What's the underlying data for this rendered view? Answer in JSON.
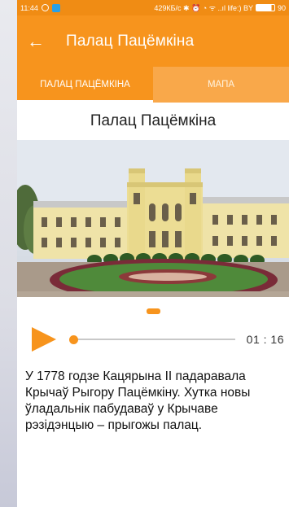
{
  "status_bar": {
    "time": "11:44",
    "network_info": "429КБ/с ✱ ⏰ ◔ ᯤ ..ıl life:) BY",
    "battery": "90"
  },
  "app_bar": {
    "back_icon": "arrow-left-icon",
    "title": "Палац Пацёмкіна"
  },
  "tabs": [
    {
      "label": "ПАЛАЦ ПАЦЁМКІНА",
      "active": true
    },
    {
      "label": "МАПА",
      "active": false
    }
  ],
  "place": {
    "title": "Палац Пацёмкіна"
  },
  "carousel": {
    "page_count": 1,
    "current": 1
  },
  "player": {
    "play_icon": "play-icon",
    "time": "01 : 16",
    "progress": 0.0
  },
  "description": "У 1778 годзе Кацярына ІІ падаравала Крычаў Рыгору Пацёмкіну. Хутка новы ўладальнік пабудаваў у Крычаве рэзідэнцыю – прыгожы палац.",
  "colors": {
    "primary": "#f7941d",
    "status_bar": "#f08c14"
  }
}
